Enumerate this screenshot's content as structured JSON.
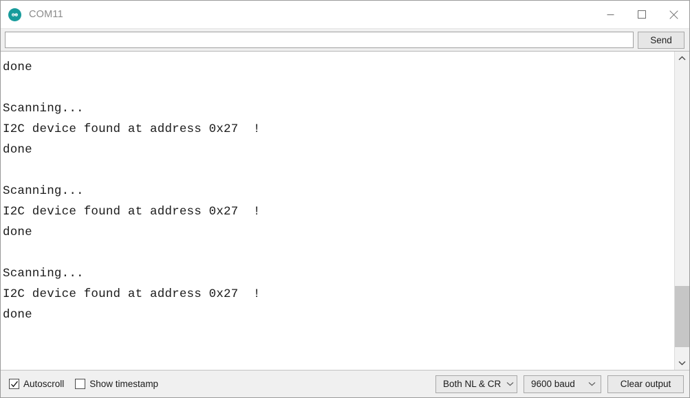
{
  "window": {
    "title": "COM11",
    "app_icon": "arduino-infinity-icon",
    "controls": {
      "minimize": "minimize-icon",
      "maximize": "maximize-icon",
      "close": "close-icon"
    }
  },
  "send_bar": {
    "input_value": "",
    "input_placeholder": "",
    "send_label": "Send"
  },
  "console": {
    "lines": [
      "I2C device found at address 0x27  !",
      "done",
      "",
      "Scanning...",
      "I2C device found at address 0x27  !",
      "done",
      "",
      "Scanning...",
      "I2C device found at address 0x27  !",
      "done",
      "",
      "Scanning...",
      "I2C device found at address 0x27  !",
      "done"
    ]
  },
  "scrollbar": {
    "up_icon": "chevron-up-icon",
    "down_icon": "chevron-down-icon"
  },
  "status_bar": {
    "autoscroll_label": "Autoscroll",
    "autoscroll_checked": true,
    "show_timestamp_label": "Show timestamp",
    "show_timestamp_checked": false,
    "line_ending": "Both NL & CR",
    "baud_rate": "9600 baud",
    "clear_label": "Clear output"
  },
  "colors": {
    "accent": "#179b9b",
    "titlebar_bg": "#ffffff",
    "chrome_bg": "#f0f0f0",
    "text": "#1a1a1a",
    "title_text": "#8b8b8b"
  }
}
